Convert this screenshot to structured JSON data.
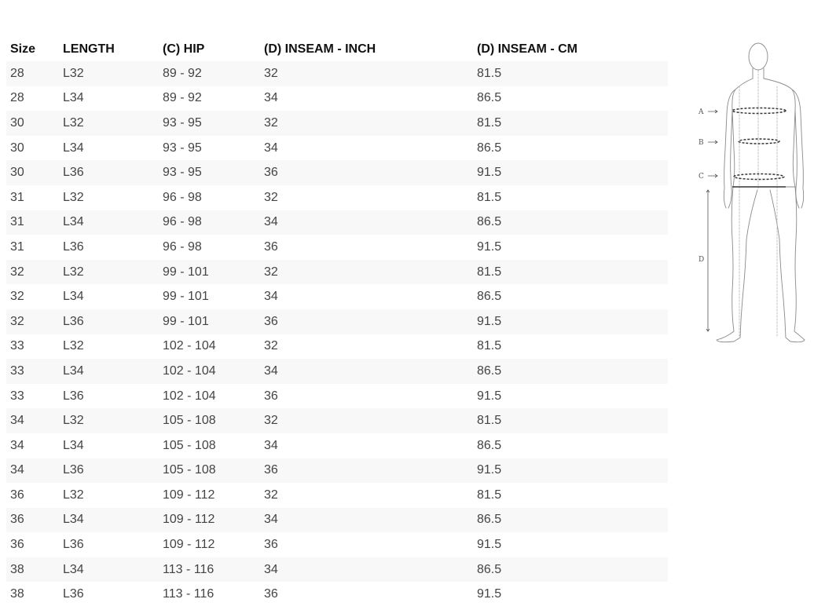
{
  "table": {
    "headers": [
      "Size",
      "LENGTH",
      "(C) HIP",
      "(D) INSEAM - INCH",
      "(D) INSEAM - CM"
    ],
    "rows": [
      [
        "28",
        "L32",
        "89 - 92",
        "32",
        "81.5"
      ],
      [
        "28",
        "L34",
        "89 - 92",
        "34",
        "86.5"
      ],
      [
        "30",
        "L32",
        "93 - 95",
        "32",
        "81.5"
      ],
      [
        "30",
        "L34",
        "93 - 95",
        "34",
        "86.5"
      ],
      [
        "30",
        "L36",
        "93 - 95",
        "36",
        "91.5"
      ],
      [
        "31",
        "L32",
        "96 - 98",
        "32",
        "81.5"
      ],
      [
        "31",
        "L34",
        "96 - 98",
        "34",
        "86.5"
      ],
      [
        "31",
        "L36",
        "96 - 98",
        "36",
        "91.5"
      ],
      [
        "32",
        "L32",
        "99 - 101",
        "32",
        "81.5"
      ],
      [
        "32",
        "L34",
        "99 - 101",
        "34",
        "86.5"
      ],
      [
        "32",
        "L36",
        "99 - 101",
        "36",
        "91.5"
      ],
      [
        "33",
        "L32",
        "102 - 104",
        "32",
        "81.5"
      ],
      [
        "33",
        "L34",
        "102 - 104",
        "34",
        "86.5"
      ],
      [
        "33",
        "L36",
        "102 - 104",
        "36",
        "91.5"
      ],
      [
        "34",
        "L32",
        "105 - 108",
        "32",
        "81.5"
      ],
      [
        "34",
        "L34",
        "105 - 108",
        "34",
        "86.5"
      ],
      [
        "34",
        "L36",
        "105 - 108",
        "36",
        "91.5"
      ],
      [
        "36",
        "L32",
        "109 - 112",
        "32",
        "81.5"
      ],
      [
        "36",
        "L34",
        "109 - 112",
        "34",
        "86.5"
      ],
      [
        "36",
        "L36",
        "109 - 112",
        "36",
        "91.5"
      ],
      [
        "38",
        "L34",
        "113 - 116",
        "34",
        "86.5"
      ],
      [
        "38",
        "L36",
        "113 - 116",
        "36",
        "91.5"
      ]
    ]
  },
  "figure": {
    "label_a": "A",
    "label_b": "B",
    "label_c": "C",
    "label_d": "D",
    "icon": "body-measurement-diagram"
  },
  "colors": {
    "row_stripe": "#f8f8f8",
    "header_text": "#111111",
    "cell_text": "#444444"
  }
}
